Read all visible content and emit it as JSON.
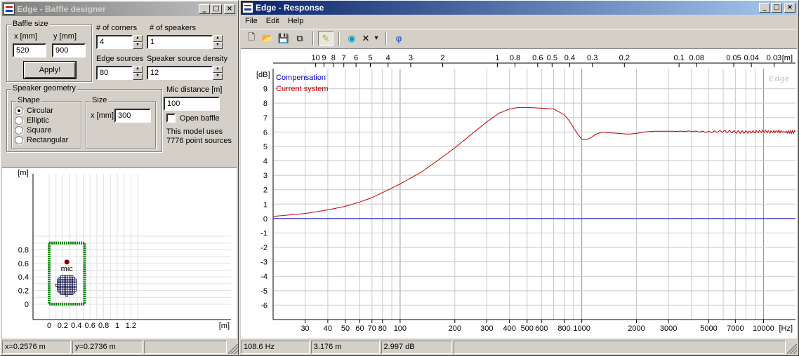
{
  "designer": {
    "title": "Edge - Baffle designer",
    "window_controls": {
      "minimize": "_",
      "maximize": "□",
      "close": "×"
    },
    "baffle_size": {
      "group_label": "Baffle size",
      "x_label": "x [mm]",
      "y_label": "y [mm]",
      "x_value": "520",
      "y_value": "900",
      "apply_label": "Apply!"
    },
    "corners": {
      "label": "# of corners",
      "value": "4"
    },
    "speakers": {
      "label": "# of speakers",
      "value": "1"
    },
    "edge_sources": {
      "label": "Edge sources",
      "value": "80"
    },
    "density": {
      "label": "Speaker source density",
      "value": "12"
    },
    "geometry": {
      "group_label": "Speaker geometry",
      "shape_label": "Shape",
      "shapes": [
        "Circular",
        "Elliptic",
        "Square",
        "Rectangular"
      ],
      "selected_shape": "Circular",
      "size_label": "Size",
      "size_x_label": "x [mm]",
      "size_x_value": "300"
    },
    "mic_distance": {
      "label": "Mic distance [m]",
      "value": "100"
    },
    "open_baffle": {
      "label": "Open baffle",
      "checked": false
    },
    "model_info": {
      "line1": "This model uses",
      "line2": "7776 point sources"
    },
    "plot": {
      "y_unit": "[m]",
      "x_unit": "[m]",
      "x_ticks": [
        "0",
        "0.2",
        "0.4",
        "0.6",
        "0.8",
        "1",
        "1.2"
      ],
      "y_ticks": [
        "0",
        "0.2",
        "0.4",
        "0.6",
        "0.8"
      ],
      "mic_label": "mic",
      "baffle_color": "#008000",
      "speaker_color": "#000040",
      "mic_color": "#800000"
    },
    "status": {
      "x": "x=0.2576 m",
      "y": "y=0.2736 m",
      "extra": ""
    }
  },
  "response": {
    "title": "Edge - Response",
    "window_controls": {
      "minimize": "_",
      "maximize": "□",
      "close": "×"
    },
    "menu": [
      "File",
      "Edit",
      "Help"
    ],
    "toolbar": [
      {
        "name": "new-icon",
        "glyph": "🗋"
      },
      {
        "name": "open-icon",
        "glyph": "📂"
      },
      {
        "name": "save-icon",
        "glyph": "💾"
      },
      {
        "name": "copy-icon",
        "glyph": "⧉"
      },
      {
        "name": "pen-icon",
        "glyph": "✎"
      },
      {
        "name": "globe-icon",
        "glyph": "◉"
      },
      {
        "name": "delete-icon",
        "glyph": "✕"
      },
      {
        "name": "dropdown-icon",
        "glyph": "▾"
      },
      {
        "name": "phi-icon",
        "glyph": "φ"
      }
    ],
    "status": {
      "freq": "108.6 Hz",
      "dist": "3.176 m",
      "level": "2.997 dB",
      "extra": ""
    }
  },
  "chart_data": {
    "type": "line",
    "title": "",
    "watermark": "Edge",
    "xlabel": "[Hz]",
    "ylabel": "[dB]",
    "x_scale": "log",
    "xlim": [
      20,
      15000
    ],
    "ylim": [
      -7,
      10
    ],
    "grid": true,
    "x_tick_labels": [
      {
        "v": 30,
        "t": "30"
      },
      {
        "v": 40,
        "t": "40"
      },
      {
        "v": 50,
        "t": "50"
      },
      {
        "v": 60,
        "t": "60"
      },
      {
        "v": 70,
        "t": "70"
      },
      {
        "v": 80,
        "t": "80"
      },
      {
        "v": 100,
        "t": "100"
      },
      {
        "v": 200,
        "t": "200"
      },
      {
        "v": 300,
        "t": "300"
      },
      {
        "v": 400,
        "t": "400"
      },
      {
        "v": 500,
        "t": "500"
      },
      {
        "v": 600,
        "t": "600"
      },
      {
        "v": 800,
        "t": "800"
      },
      {
        "v": 1000,
        "t": "1000"
      },
      {
        "v": 2000,
        "t": "2000"
      },
      {
        "v": 3000,
        "t": "3000"
      },
      {
        "v": 5000,
        "t": "5000"
      },
      {
        "v": 7000,
        "t": "7000"
      },
      {
        "v": 10000,
        "t": "10000"
      }
    ],
    "top_axis": {
      "unit": "[m]",
      "ticks": [
        {
          "v": 34.3,
          "t": "10"
        },
        {
          "v": 38.1,
          "t": "9"
        },
        {
          "v": 42.9,
          "t": "8"
        },
        {
          "v": 49,
          "t": "7"
        },
        {
          "v": 57.2,
          "t": "6"
        },
        {
          "v": 68.6,
          "t": "5"
        },
        {
          "v": 85.8,
          "t": "4"
        },
        {
          "v": 114.3,
          "t": "3"
        },
        {
          "v": 171.5,
          "t": "2"
        },
        {
          "v": 343,
          "t": "1"
        },
        {
          "v": 428.8,
          "t": "0.8"
        },
        {
          "v": 571.7,
          "t": "0.6"
        },
        {
          "v": 686,
          "t": "0.5"
        },
        {
          "v": 857.5,
          "t": "0.4"
        },
        {
          "v": 1143.3,
          "t": "0.3"
        },
        {
          "v": 1715,
          "t": "0.2"
        },
        {
          "v": 3430,
          "t": "0.1"
        },
        {
          "v": 4287.5,
          "t": "0.08"
        },
        {
          "v": 6860,
          "t": "0.05"
        },
        {
          "v": 8575,
          "t": "0.04"
        },
        {
          "v": 11433,
          "t": "0.03"
        }
      ]
    },
    "y_ticks": [
      9,
      8,
      7,
      6,
      5,
      4,
      3,
      2,
      1,
      0,
      -1,
      -2,
      -3,
      -4,
      -5,
      -6
    ],
    "series": [
      {
        "name": "Compensation",
        "color": "#0000c0",
        "x": [
          20,
          15000
        ],
        "y": [
          0,
          0
        ]
      },
      {
        "name": "Current system",
        "color": "#c00000",
        "x": [
          20,
          30,
          40,
          50,
          60,
          70,
          80,
          100,
          130,
          160,
          200,
          250,
          300,
          350,
          400,
          450,
          500,
          600,
          700,
          800,
          850,
          900,
          950,
          1000,
          1050,
          1100,
          1200,
          1300,
          1400,
          1600,
          1800,
          2000,
          2200,
          2500,
          3000,
          4000,
          5000,
          6000,
          7000,
          8000,
          9000,
          10000,
          11000,
          12000,
          13000,
          15000
        ],
        "y": [
          0.15,
          0.35,
          0.6,
          0.85,
          1.15,
          1.45,
          1.8,
          2.4,
          3.2,
          4.0,
          4.9,
          5.9,
          6.7,
          7.3,
          7.6,
          7.7,
          7.7,
          7.65,
          7.6,
          7.2,
          6.8,
          6.3,
          5.85,
          5.5,
          5.45,
          5.55,
          5.85,
          6.0,
          5.95,
          5.9,
          5.85,
          5.9,
          6.0,
          6.05,
          6.05,
          6.05,
          6.0,
          6.05,
          6.0,
          6.0,
          6.0,
          6.05,
          6.0,
          6.05,
          6.0,
          6.0
        ]
      }
    ]
  }
}
